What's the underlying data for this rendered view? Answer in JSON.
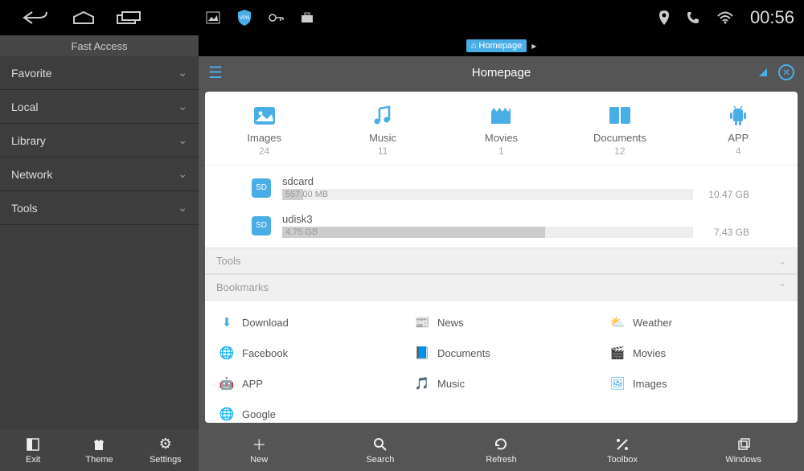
{
  "statusBar": {
    "time": "00:56"
  },
  "sidebar": {
    "header": "Fast Access",
    "items": [
      {
        "label": "Favorite"
      },
      {
        "label": "Local"
      },
      {
        "label": "Library"
      },
      {
        "label": "Network"
      },
      {
        "label": "Tools"
      }
    ],
    "bottomButtons": [
      {
        "label": "Exit"
      },
      {
        "label": "Theme"
      },
      {
        "label": "Settings"
      }
    ]
  },
  "tab": {
    "label": "Homepage"
  },
  "content": {
    "title": "Homepage",
    "categories": [
      {
        "label": "Images",
        "count": "24"
      },
      {
        "label": "Music",
        "count": "11"
      },
      {
        "label": "Movies",
        "count": "1"
      },
      {
        "label": "Documents",
        "count": "12"
      },
      {
        "label": "APP",
        "count": "4"
      }
    ],
    "storage": [
      {
        "name": "sdcard",
        "used": "557.00 MB",
        "total": "10.47 GB",
        "percent": 5
      },
      {
        "name": "udisk3",
        "used": "4.75 GB",
        "total": "7.43 GB",
        "percent": 64
      }
    ],
    "sections": {
      "tools": "Tools",
      "bookmarks": "Bookmarks"
    },
    "bookmarks": [
      {
        "label": "Download",
        "icon": "download"
      },
      {
        "label": "News",
        "icon": "news"
      },
      {
        "label": "Weather",
        "icon": "weather"
      },
      {
        "label": "Facebook",
        "icon": "globe"
      },
      {
        "label": "Documents",
        "icon": "documents"
      },
      {
        "label": "Movies",
        "icon": "movies"
      },
      {
        "label": "APP",
        "icon": "app"
      },
      {
        "label": "Music",
        "icon": "music"
      },
      {
        "label": "Images",
        "icon": "images"
      },
      {
        "label": "Google",
        "icon": "globe"
      }
    ],
    "bottomButtons": [
      {
        "label": "New"
      },
      {
        "label": "Search"
      },
      {
        "label": "Refresh"
      },
      {
        "label": "Toolbox"
      },
      {
        "label": "Windows"
      }
    ]
  }
}
